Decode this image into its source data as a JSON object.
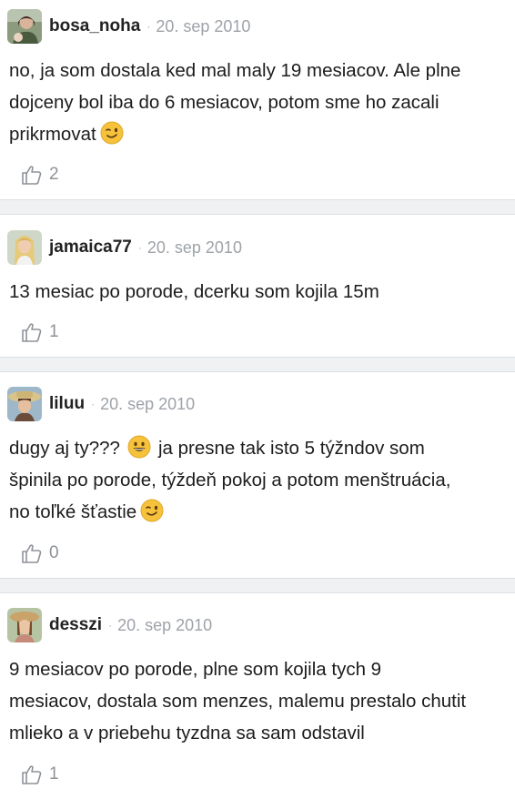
{
  "comments": [
    {
      "username": "bosa_noha",
      "date": "20. sep 2010",
      "text_lines": [
        "no, ja som dostala ked mal maly 19 mesiacov. Ale plne",
        "dojceny bol iba do 6 mesiacov, potom sme ho zacali",
        "prikrmovat"
      ],
      "emoji": "wink",
      "likes": "2"
    },
    {
      "username": "jamaica77",
      "date": "20. sep 2010",
      "text_lines": [
        "13 mesiac po porode, dcerku som kojila 15m"
      ],
      "likes": "1"
    },
    {
      "username": "liluu",
      "date": "20. sep 2010",
      "text_line1_start": "dugy aj ty???",
      "emoji_inline": "grin",
      "text_line1_end": "ja presne tak isto 5 týžndov som",
      "text_lines_rest": [
        "špinila po porode, týždeň pokoj a potom menštruácia,",
        "no toľké šťastie"
      ],
      "emoji": "wink",
      "likes": "0"
    },
    {
      "username": "desszi",
      "date": "20. sep 2010",
      "text_lines": [
        "9 mesiacov po porode, plne som kojila tych 9",
        "mesiacov, dostala som menzes, malemu prestalo chutit",
        "mlieko a v priebehu tyzdna sa sam odstavil"
      ],
      "likes": "1"
    }
  ],
  "separator": "·",
  "icons": {
    "like": "thumbs-up-icon",
    "wink": "winking-face-icon",
    "grin": "grinning-face-icon"
  },
  "colors": {
    "divider": "#f0f1f3",
    "meta": "#9ea2a8",
    "emoji": "#f6c23b"
  }
}
